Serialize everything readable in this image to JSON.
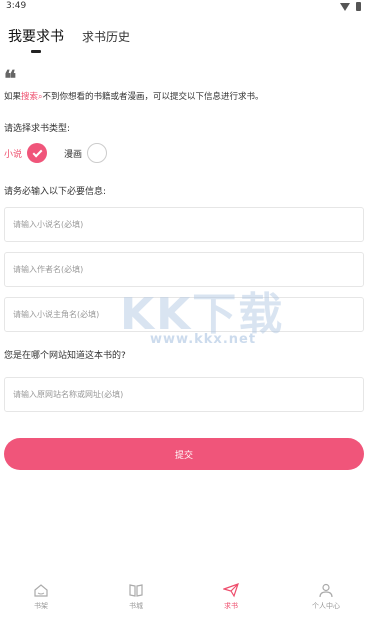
{
  "status_bar": {
    "time": "3:49"
  },
  "tabs": [
    {
      "label": "我要求书"
    },
    {
      "label": "求书历史"
    }
  ],
  "quote": "❛❛",
  "intro": {
    "before": "如果",
    "link": "搜索",
    "after": "不到你想看的书籍或者漫画，可以提交以下信息进行求书。"
  },
  "type_section": {
    "label": "请选择求书类型:",
    "options": [
      {
        "label": "小说",
        "selected": true
      },
      {
        "label": "漫画",
        "selected": false
      }
    ]
  },
  "info_section": {
    "label": "请务必输入以下必要信息:",
    "fields": [
      {
        "placeholder": "请输入小说名(必填)",
        "value": ""
      },
      {
        "placeholder": "请输入作者名(必填)",
        "value": ""
      },
      {
        "placeholder": "请输入小说主角名(必填)",
        "value": ""
      }
    ]
  },
  "source_section": {
    "label": "您是在哪个网站知道这本书的?",
    "field": {
      "placeholder": "请输入原网站名称或网址(必填)",
      "value": ""
    }
  },
  "submit_label": "提交",
  "watermark": {
    "text": "KK下载",
    "url": "www.kkx.net"
  },
  "bottom_nav": [
    {
      "label": "书架",
      "icon": "bookshelf-icon",
      "active": false
    },
    {
      "label": "书城",
      "icon": "open-book-icon",
      "active": false
    },
    {
      "label": "求书",
      "icon": "paper-plane-icon",
      "active": true
    },
    {
      "label": "个人中心",
      "icon": "person-icon",
      "active": false
    }
  ],
  "colors": {
    "accent": "#f0557a",
    "text": "#333333",
    "muted": "#999999"
  }
}
